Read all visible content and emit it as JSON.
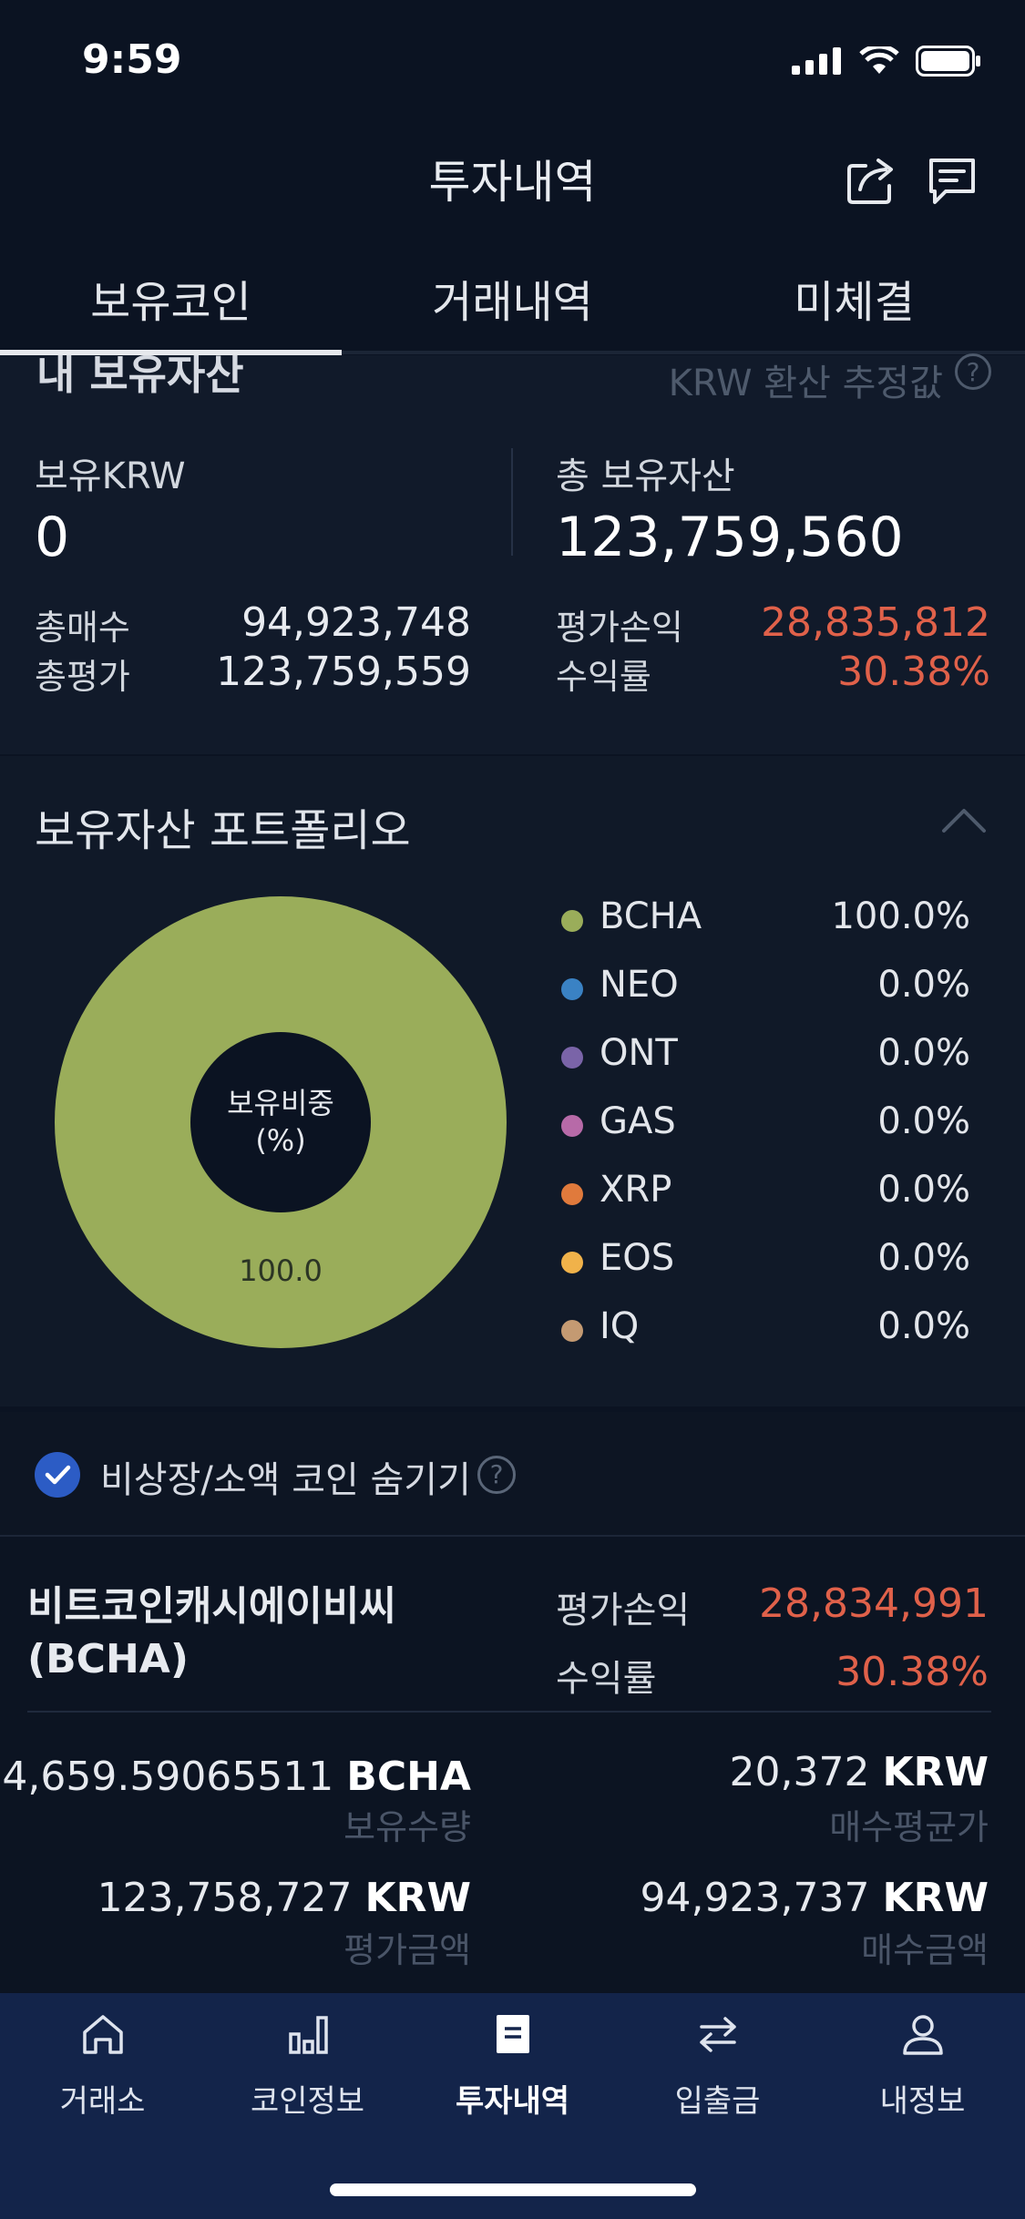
{
  "status_bar": {
    "time": "9:59"
  },
  "header": {
    "title": "투자내역",
    "share_icon": "share-icon",
    "chat_icon": "chat-icon"
  },
  "tabs": [
    {
      "label": "보유코인",
      "active": true
    },
    {
      "label": "거래내역",
      "active": false
    },
    {
      "label": "미체결",
      "active": false
    }
  ],
  "summary": {
    "title": "내 보유자산",
    "note": "KRW 환산 추정값",
    "help": "?",
    "krw_label": "보유KRW",
    "krw_value": "0",
    "total_label": "총 보유자산",
    "total_value": "123,759,560",
    "buy_label": "총매수",
    "buy_value": "94,923,748",
    "eval_label": "총평가",
    "eval_value": "123,759,559",
    "pl_label": "평가손익",
    "pl_value": "28,835,812",
    "rate_label": "수익률",
    "rate_value": "30.38%"
  },
  "portfolio": {
    "title": "보유자산 포트폴리오",
    "center_label_1": "보유비중",
    "center_label_2": "(%)",
    "slice_label": "100.0",
    "legend": [
      {
        "name": "BCHA",
        "pct": "100.0%",
        "value": 100.0,
        "color": "#9aad5a"
      },
      {
        "name": "NEO",
        "pct": "0.0%",
        "value": 0.0,
        "color": "#3a82c4"
      },
      {
        "name": "ONT",
        "pct": "0.0%",
        "value": 0.0,
        "color": "#7a64a8"
      },
      {
        "name": "GAS",
        "pct": "0.0%",
        "value": 0.0,
        "color": "#b76aa8"
      },
      {
        "name": "XRP",
        "pct": "0.0%",
        "value": 0.0,
        "color": "#e07a3c"
      },
      {
        "name": "EOS",
        "pct": "0.0%",
        "value": 0.0,
        "color": "#f0b24a"
      },
      {
        "name": "IQ",
        "pct": "0.0%",
        "value": 0.0,
        "color": "#c49a72"
      }
    ]
  },
  "hide_option": {
    "label": "비상장/소액 코인 숨기기",
    "checked": true,
    "help": "?"
  },
  "holding": {
    "name_line1": "비트코인캐시에이비씨",
    "name_line2": "(BCHA)",
    "pl_label": "평가손익",
    "pl_value": "28,834,991",
    "rate_label": "수익률",
    "rate_value": "30.38%",
    "qty_number": "4,659.59065511",
    "qty_unit": "BCHA",
    "qty_label": "보유수량",
    "avg_number": "20,372",
    "avg_unit": "KRW",
    "avg_label": "매수평균가",
    "eval_number": "123,758,727",
    "eval_unit": "KRW",
    "eval_label": "평가금액",
    "buy_number": "94,923,737",
    "buy_unit": "KRW",
    "buy_label": "매수금액"
  },
  "bottom_nav": [
    {
      "label": "거래소",
      "icon": "home-icon",
      "active": false
    },
    {
      "label": "코인정보",
      "icon": "bar-chart-icon",
      "active": false
    },
    {
      "label": "투자내역",
      "icon": "document-icon",
      "active": true
    },
    {
      "label": "입출금",
      "icon": "transfer-icon",
      "active": false
    },
    {
      "label": "내정보",
      "icon": "user-icon",
      "active": false
    }
  ]
}
